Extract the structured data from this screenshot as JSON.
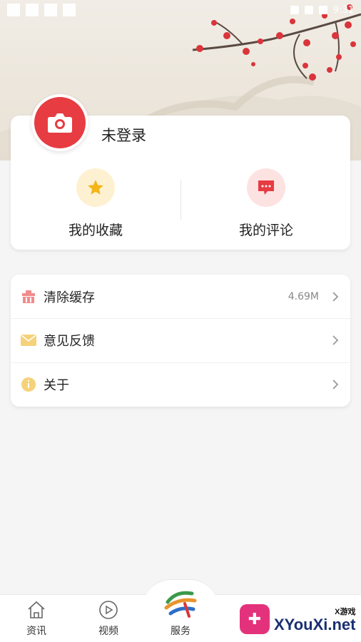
{
  "status_bar": {
    "time": "9:31"
  },
  "profile": {
    "login_status": "未登录",
    "actions": [
      {
        "label": "我的收藏",
        "icon": "star-icon",
        "bg": "#fdf1d2",
        "color": "#f3b518"
      },
      {
        "label": "我的评论",
        "icon": "comment-icon",
        "bg": "#fde2e2",
        "color": "#e63c42"
      }
    ]
  },
  "settings": [
    {
      "label": "清除缓存",
      "value": "4.69M",
      "icon": "clear-cache-icon",
      "color": "#f28b8b"
    },
    {
      "label": "意见反馈",
      "value": "",
      "icon": "mail-icon",
      "color": "#f5d27a"
    },
    {
      "label": "关于",
      "value": "",
      "icon": "info-icon",
      "color": "#f5d27a"
    }
  ],
  "tabbar": {
    "tabs": [
      {
        "label": "资讯",
        "icon": "home-icon"
      },
      {
        "label": "视频",
        "icon": "play-icon"
      },
      {
        "label": "服务",
        "icon": "service-logo-icon"
      }
    ]
  },
  "watermark": {
    "small": "X游戏",
    "big": "XYouXi.net"
  },
  "colors": {
    "accent": "#e63c42",
    "background": "#f5f5f5"
  }
}
